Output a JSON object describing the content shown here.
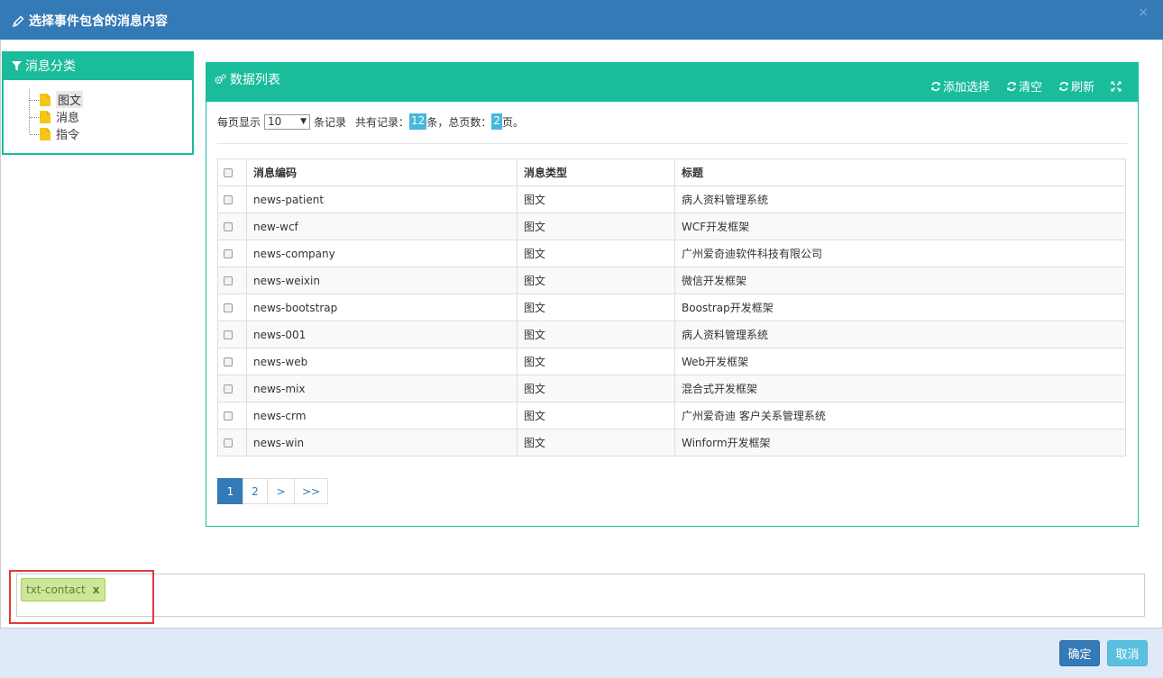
{
  "dialog": {
    "title": "选择事件包含的消息内容",
    "close_glyph": "×"
  },
  "category_panel": {
    "title": "消息分类",
    "nodes": [
      {
        "label": "图文",
        "selected": true
      },
      {
        "label": "消息",
        "selected": false
      },
      {
        "label": "指令",
        "selected": false
      }
    ]
  },
  "data_panel": {
    "title": "数据列表",
    "tools": {
      "add": "添加选择",
      "clear": "清空",
      "refresh": "刷新"
    },
    "pager_info": {
      "prefix": "每页显示",
      "page_size": "10",
      "suffix": "条记录",
      "total_label": "共有记录：",
      "total": "12",
      "total_unit": "条，总页数：",
      "pages": "2",
      "pages_unit": "页。"
    },
    "columns": [
      "消息编码",
      "消息类型",
      "标题"
    ],
    "rows": [
      {
        "code": "news-patient",
        "type": "图文",
        "title": "病人资料管理系统"
      },
      {
        "code": "new-wcf",
        "type": "图文",
        "title": "WCF开发框架"
      },
      {
        "code": "news-company",
        "type": "图文",
        "title": "广州爱奇迪软件科技有限公司"
      },
      {
        "code": "news-weixin",
        "type": "图文",
        "title": "微信开发框架"
      },
      {
        "code": "news-bootstrap",
        "type": "图文",
        "title": "Boostrap开发框架"
      },
      {
        "code": "news-001",
        "type": "图文",
        "title": "病人资料管理系统"
      },
      {
        "code": "news-web",
        "type": "图文",
        "title": "Web开发框架"
      },
      {
        "code": "news-mix",
        "type": "图文",
        "title": "混合式开发框架"
      },
      {
        "code": "news-crm",
        "type": "图文",
        "title": "广州爱奇迪 客户关系管理系统"
      },
      {
        "code": "news-win",
        "type": "图文",
        "title": "Winform开发框架"
      }
    ],
    "pagination": [
      "1",
      "2",
      ">",
      ">>"
    ],
    "current_page": "1"
  },
  "selected_tags": [
    {
      "label": "txt-contact",
      "remove": "x"
    }
  ],
  "footer": {
    "ok_label": "确定",
    "cancel_label": "取消"
  },
  "colors": {
    "header": "#337ab7",
    "panel_accent": "#1abc9c",
    "badge": "#46b8da",
    "tag_bg": "#cde69c",
    "highlight": "#e03a3a"
  }
}
